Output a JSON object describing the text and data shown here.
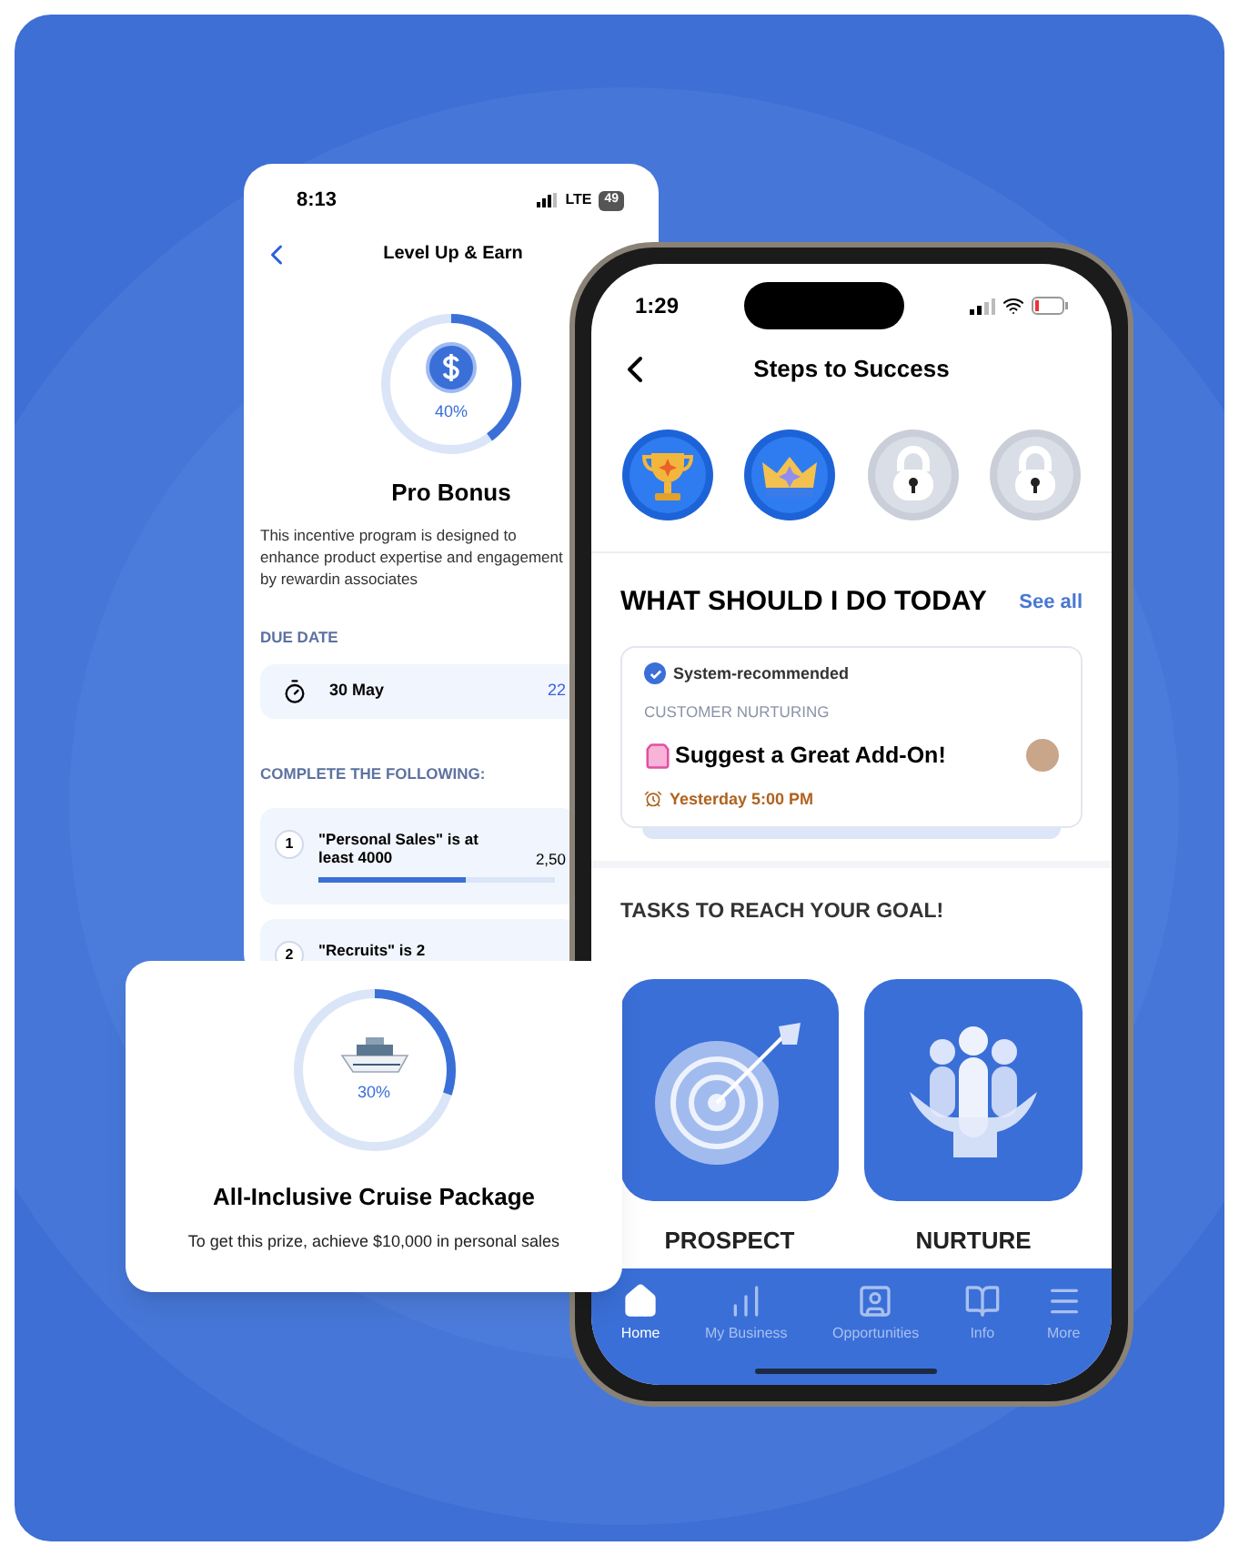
{
  "back_screen": {
    "status": {
      "time": "8:13",
      "network": "LTE",
      "battery": "49"
    },
    "title": "Level Up & Earn",
    "progress": {
      "level": 0.4,
      "label": "40%"
    },
    "program_title": "Pro Bonus",
    "description": "This incentive program is designed to enhance product expertise and engagement by rewardin associates",
    "due_date": {
      "heading": "DUE DATE",
      "date": "30 May",
      "remaining": "22"
    },
    "requirements_heading": "COMPLETE THE FOLLOWING:",
    "requirements": [
      {
        "number": "1",
        "text": "\"Personal Sales\" is at least 4000",
        "value": "2,50",
        "level": 0.62
      },
      {
        "number": "2",
        "text": "\"Recruits\" is 2"
      }
    ]
  },
  "prize_card": {
    "progress": {
      "level": 0.3,
      "label": "30%"
    },
    "title": "All-Inclusive Cruise Package",
    "subtitle": "To get this prize, achieve $10,000 in personal sales"
  },
  "front_screen": {
    "status": {
      "time": "1:29"
    },
    "title": "Steps to Success",
    "badges": [
      {
        "kind": "trophy",
        "unlocked": true
      },
      {
        "kind": "crown",
        "unlocked": true
      },
      {
        "kind": "lock",
        "unlocked": false
      },
      {
        "kind": "lock",
        "unlocked": false
      }
    ],
    "today": {
      "heading": "WHAT SHOULD I DO TODAY",
      "link": "See all",
      "card": {
        "tag": "System-recommended",
        "category": "CUSTOMER NURTURING",
        "title": "Suggest a Great Add-On!",
        "time": "Yesterday 5:00 PM"
      }
    },
    "tasks": {
      "heading": "TASKS TO REACH YOUR GOAL!",
      "tiles": [
        {
          "kind": "target",
          "label": "PROSPECT"
        },
        {
          "kind": "people",
          "label": "NURTURE"
        }
      ]
    },
    "nav": [
      {
        "kind": "home",
        "label": "Home",
        "selected": true
      },
      {
        "kind": "chart",
        "label": "My Business",
        "selected": false
      },
      {
        "kind": "contact",
        "label": "Opportunities",
        "selected": false
      },
      {
        "kind": "book",
        "label": "Info",
        "selected": false
      },
      {
        "kind": "menu",
        "label": "More",
        "selected": false
      }
    ]
  }
}
